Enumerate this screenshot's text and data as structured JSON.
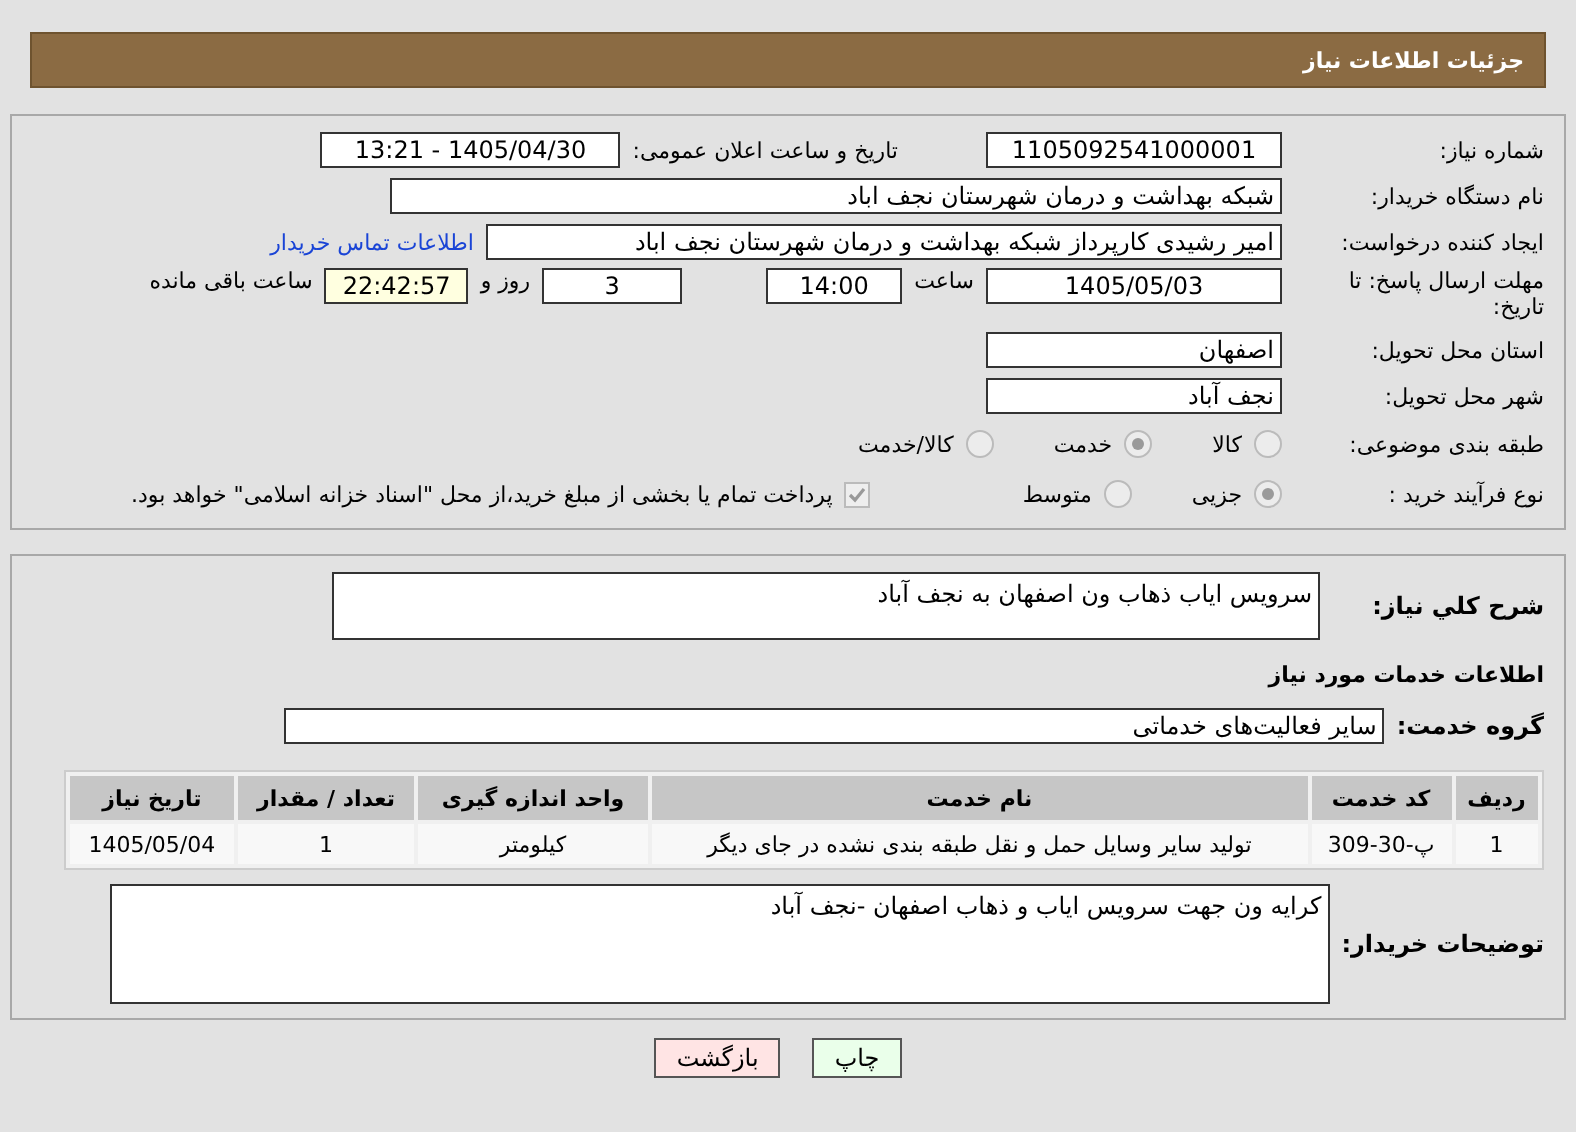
{
  "header": {
    "title": "جزئیات اطلاعات نیاز"
  },
  "details": {
    "need_number": {
      "label": "شماره نیاز:",
      "value": "1105092541000001"
    },
    "announce": {
      "label": "تاریخ و ساعت اعلان عمومی:",
      "value": "1405/04/30 - 13:21"
    },
    "buyer_org": {
      "label": "نام دستگاه خریدار:",
      "value": "شبکه بهداشت و درمان شهرستان نجف اباد"
    },
    "requester": {
      "label": "ایجاد کننده درخواست:",
      "value": "امیر رشیدی کارپرداز شبکه بهداشت و درمان شهرستان نجف اباد",
      "link": "اطلاعات تماس خریدار"
    },
    "deadline": {
      "label": "مهلت ارسال پاسخ: تا تاریخ:",
      "date": "1405/05/03",
      "time_label": "ساعت",
      "time": "14:00",
      "days": "3",
      "days_label": "روز و",
      "remaining": "22:42:57",
      "remaining_label": "ساعت باقی مانده"
    },
    "province": {
      "label": "استان محل تحویل:",
      "value": "اصفهان"
    },
    "city": {
      "label": "شهر محل تحویل:",
      "value": "نجف آباد"
    },
    "category": {
      "label": "طبقه بندی موضوعی:",
      "options": [
        {
          "label": "کالا",
          "selected": false
        },
        {
          "label": "خدمت",
          "selected": true
        },
        {
          "label": "کالا/خدمت",
          "selected": false
        }
      ]
    },
    "process": {
      "label": "نوع فرآیند خرید :",
      "options": [
        {
          "label": "جزیی",
          "selected": true
        },
        {
          "label": "متوسط",
          "selected": false
        }
      ],
      "treasury": {
        "checked": true,
        "label": "پرداخت تمام یا بخشی از مبلغ خرید،از محل \"اسناد خزانه اسلامی\" خواهد بود."
      }
    }
  },
  "services": {
    "summary": {
      "label": "شرح کلي نياز:",
      "value": "سرویس ایاب ذهاب ون اصفهان به نجف آباد"
    },
    "heading": "اطلاعات خدمات مورد نیاز",
    "group": {
      "label": "گروه خدمت:",
      "value": "سایر فعالیت‌های خدماتی"
    },
    "table": {
      "columns": [
        "ردیف",
        "کد خدمت",
        "نام خدمت",
        "واحد اندازه گیری",
        "تعداد / مقدار",
        "تاریخ نیاز"
      ],
      "rows": [
        [
          "1",
          "پ-30-309",
          "تولید سایر وسایل حمل و نقل طبقه بندی نشده در جای دیگر",
          "کیلومتر",
          "1",
          "1405/05/04"
        ]
      ]
    },
    "notes": {
      "label": "توضیحات خریدار:",
      "value": "کرایه ون  جهت سرویس ایاب و ذهاب اصفهان -نجف آباد"
    }
  },
  "buttons": [
    {
      "label": "چاپ",
      "kind": "print"
    },
    {
      "label": "بازگشت",
      "kind": "back"
    }
  ]
}
